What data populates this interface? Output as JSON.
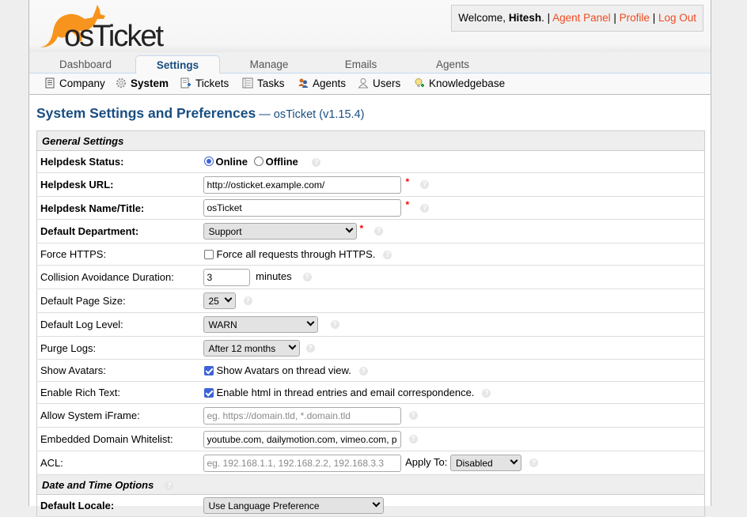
{
  "header": {
    "logo_alt": "osTicket",
    "welcome_prefix": "Welcome, ",
    "user_name": "Hitesh",
    "welcome_suffix": ". | ",
    "links": [
      "Agent Panel",
      "Profile",
      "Log Out"
    ],
    "separator": " | "
  },
  "nav": {
    "tabs": [
      "Dashboard",
      "Settings",
      "Manage",
      "Emails",
      "Agents"
    ],
    "active_tab": "Settings"
  },
  "subnav": {
    "items": [
      {
        "label": "Company",
        "icon": "company-icon"
      },
      {
        "label": "System",
        "icon": "gear-icon"
      },
      {
        "label": "Tickets",
        "icon": "tickets-icon"
      },
      {
        "label": "Tasks",
        "icon": "tasks-icon"
      },
      {
        "label": "Agents",
        "icon": "agents-icon"
      },
      {
        "label": "Users",
        "icon": "users-icon"
      },
      {
        "label": "Knowledgebase",
        "icon": "knowledgebase-icon"
      }
    ],
    "active": "System"
  },
  "page": {
    "title": "System Settings and Preferences",
    "subtitle": " — osTicket (v1.15.4)"
  },
  "general": {
    "section_title": "General Settings",
    "helpdesk_status": {
      "label": "Helpdesk Status:",
      "options": [
        "Online",
        "Offline"
      ],
      "selected": "Online"
    },
    "helpdesk_url": {
      "label": "Helpdesk URL:",
      "value": "http://osticket.example.com/"
    },
    "helpdesk_name": {
      "label": "Helpdesk Name/Title:",
      "value": "osTicket"
    },
    "default_department": {
      "label": "Default Department:",
      "value": "Support"
    },
    "force_https": {
      "label": "Force HTTPS:",
      "text": "Force all requests through HTTPS.",
      "checked": false
    },
    "collision": {
      "label": "Collision Avoidance Duration:",
      "value": "3",
      "unit": "minutes"
    },
    "page_size": {
      "label": "Default Page Size:",
      "value": "25"
    },
    "log_level": {
      "label": "Default Log Level:",
      "value": "WARN"
    },
    "purge_logs": {
      "label": "Purge Logs:",
      "value": "After 12 months"
    },
    "show_avatars": {
      "label": "Show Avatars:",
      "text": "Show Avatars on thread view.",
      "checked": true
    },
    "rich_text": {
      "label": "Enable Rich Text:",
      "text": "Enable html in thread entries and email correspondence.",
      "checked": true
    },
    "iframe": {
      "label": "Allow System iFrame:",
      "value": "",
      "placeholder": "eg. https://domain.tld, *.domain.tld"
    },
    "whitelist": {
      "label": "Embedded Domain Whitelist:",
      "value": "youtube.com, dailymotion.com, vimeo.com, p"
    },
    "acl": {
      "label": "ACL:",
      "value": "",
      "placeholder": "eg. 192.168.1.1, 192.168.2.2, 192.168.3.3",
      "apply_to_label": "Apply To:",
      "apply_to_value": "Disabled"
    }
  },
  "datetime": {
    "section_title": "Date and Time Options",
    "default_locale": {
      "label": "Default Locale:",
      "value": "Use Language Preference"
    }
  },
  "required_marker": "*",
  "help_glyph": "?",
  "colors": {
    "brand_blue": "#184e81",
    "link_orange": "#f04b22",
    "logo_orange": "#f7941d"
  }
}
